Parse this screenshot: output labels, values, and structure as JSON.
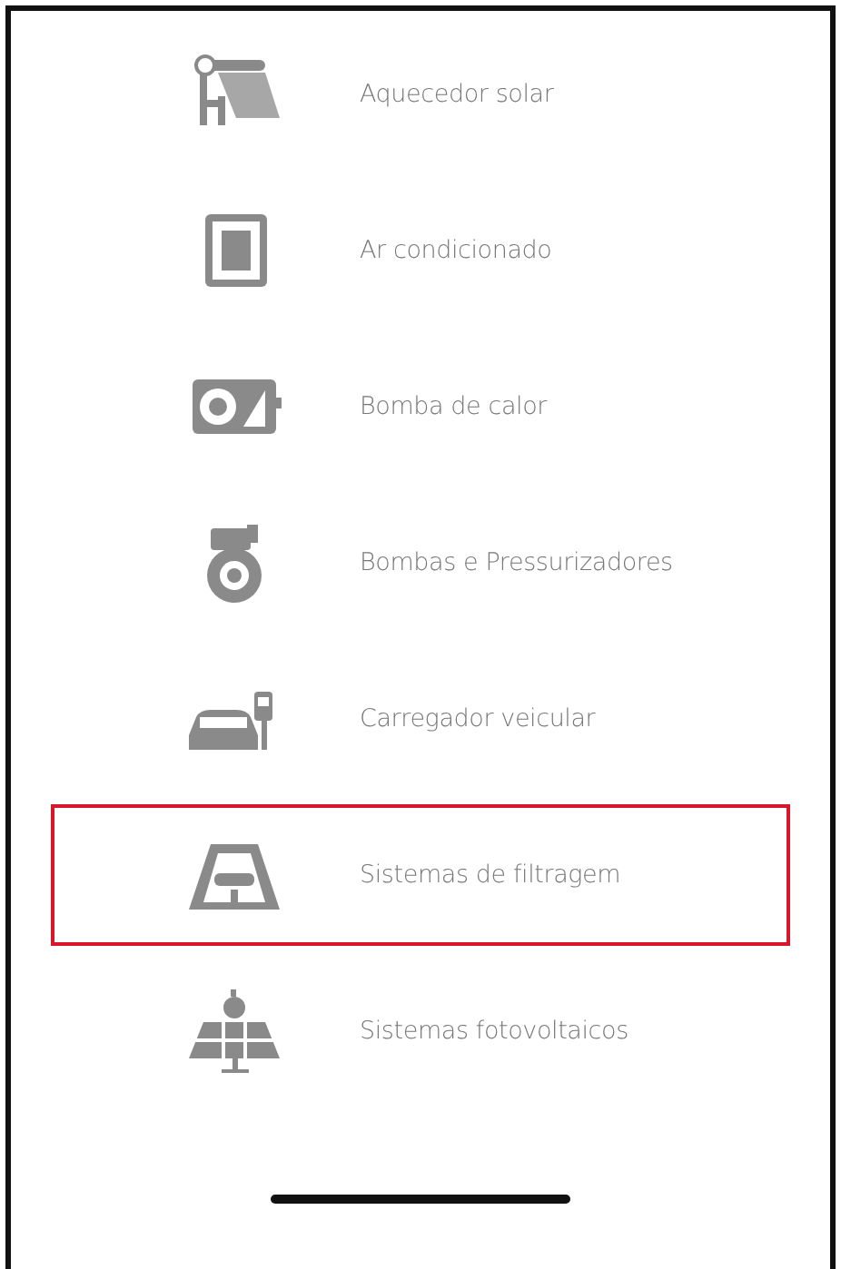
{
  "items": [
    {
      "label": "Aquecedor solar",
      "kind": "heater",
      "selected": false
    },
    {
      "label": "Ar condicionado",
      "kind": "conditioner",
      "selected": false
    },
    {
      "label": "Bomba de calor",
      "kind": "heatpump",
      "selected": false
    },
    {
      "label": "Bombas e Pressurizadores",
      "kind": "pump",
      "selected": false
    },
    {
      "label": "Carregador veicular",
      "kind": "charger",
      "selected": false
    },
    {
      "label": "Sistemas de filtragem",
      "kind": "filter",
      "selected": true
    },
    {
      "label": "Sistemas fotovoltaicos",
      "kind": "photovoltaic",
      "selected": false
    }
  ]
}
